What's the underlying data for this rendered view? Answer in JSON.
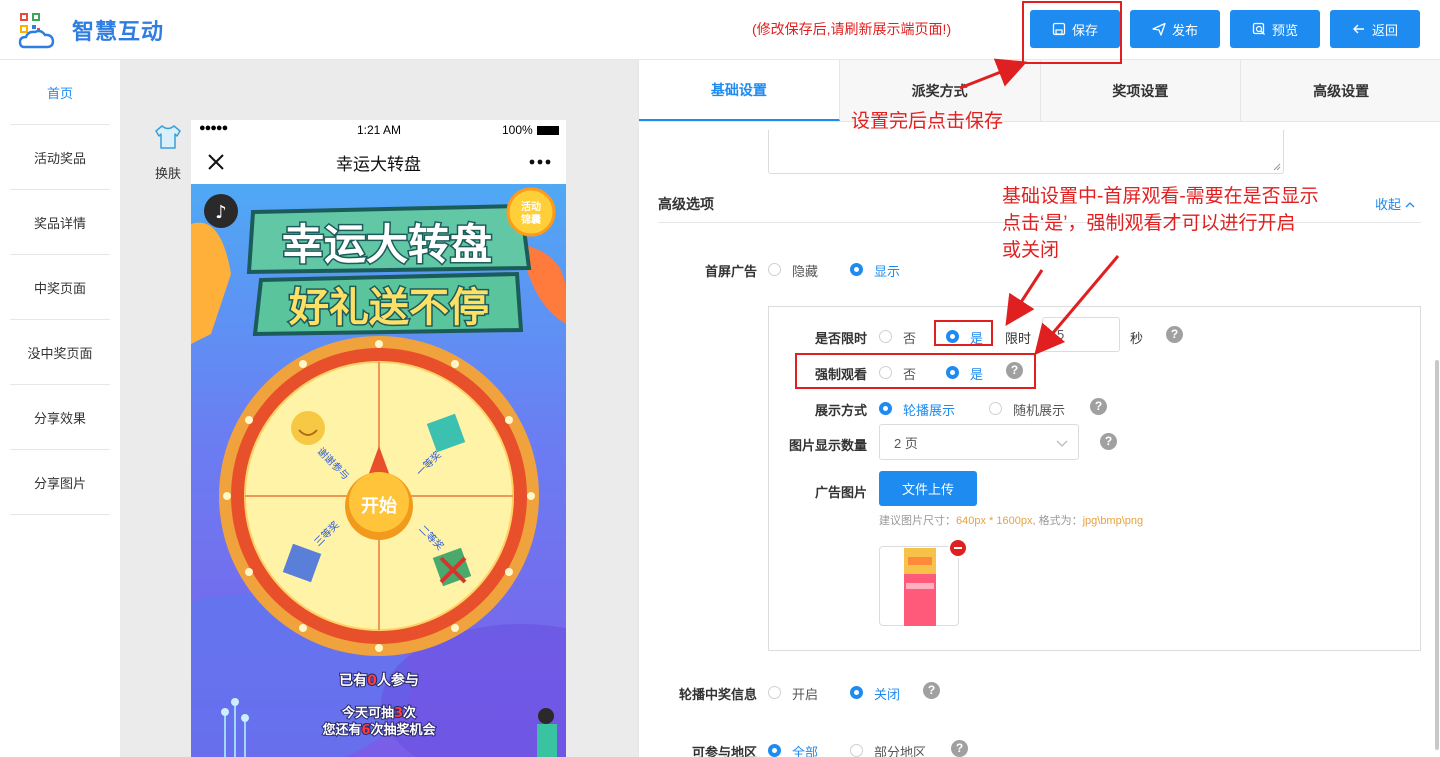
{
  "app": {
    "brand": "智慧互动",
    "notice": "(修改保存后,请刷新展示端页面!)",
    "actions": {
      "save": "保存",
      "publish": "发布",
      "preview": "预览",
      "back": "返回"
    }
  },
  "sidebar": {
    "items": [
      "首页",
      "活动奖品",
      "奖品详情",
      "中奖页面",
      "没中奖页面",
      "分享效果",
      "分享图片"
    ],
    "active_index": 0
  },
  "preview": {
    "skin_label": "换肤",
    "status": {
      "carrier": "●●●●●",
      "time": "1:21 AM",
      "battery": "100%"
    },
    "nav_title": "幸运大转盘",
    "game": {
      "badge_line1": "活动",
      "badge_line2": "锦囊",
      "title_line1": "幸运大转盘",
      "title_line2": "好礼送不停",
      "wheel_prizes": [
        "谢谢参与",
        "一等奖",
        "二等奖",
        "三等奖"
      ],
      "start_label": "开始",
      "participants_prefix": "已有",
      "participants_count": "0",
      "participants_suffix": "人参与",
      "today_prefix": "今天可抽",
      "today_count": "3",
      "today_suffix": "次",
      "remaining_prefix": "您还有",
      "remaining_count": "6",
      "remaining_suffix": "次抽奖机会"
    }
  },
  "panel": {
    "tabs": [
      "基础设置",
      "派奖方式",
      "奖项设置",
      "高级设置"
    ],
    "active_tab": 0,
    "section_title": "高级选项",
    "collapse_label": "收起",
    "splash_ad": {
      "label": "首屏广告",
      "options": [
        "隐藏",
        "显示"
      ],
      "selected": "显示"
    },
    "time_limit": {
      "label": "是否限时",
      "options": [
        "否",
        "是"
      ],
      "selected": "是",
      "limit_label": "限时",
      "value": "5",
      "unit": "秒"
    },
    "force_watch": {
      "label": "强制观看",
      "options": [
        "否",
        "是"
      ],
      "selected": "是"
    },
    "display_mode": {
      "label": "展示方式",
      "options": [
        "轮播展示",
        "随机展示"
      ],
      "selected": "轮播展示"
    },
    "image_count": {
      "label": "图片显示数量",
      "value": "2 页"
    },
    "ad_image": {
      "label": "广告图片",
      "upload_label": "文件上传",
      "hint_prefix": "建议图片尺寸：",
      "hint_size": "640px * 1600px",
      "hint_mid": ", 格式为：",
      "hint_format": "jpg\\bmp\\png"
    },
    "winner_scroll": {
      "label": "轮播中奖信息",
      "options": [
        "开启",
        "关闭"
      ],
      "selected": "关闭"
    },
    "region": {
      "label": "可参与地区",
      "options": [
        "全部",
        "部分地区"
      ],
      "selected": "全部"
    }
  },
  "annotations": {
    "save_hint": "设置完后点击保存",
    "force_line1": "基础设置中-首屏观看-需要在是否显示",
    "force_line2": "点击‘是’，强制观看才可以进行开启",
    "force_line3": "或关闭"
  },
  "colors": {
    "primary": "#1e8bf0",
    "annotation": "#e02020",
    "accent": "#e8a23a"
  }
}
